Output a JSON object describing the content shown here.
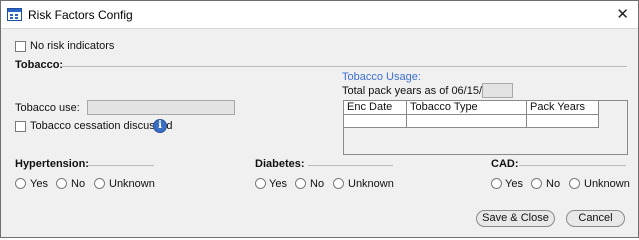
{
  "window": {
    "title": "Risk Factors Config"
  },
  "no_risk": {
    "label": "No risk indicators"
  },
  "tobacco": {
    "section_label": "Tobacco:",
    "usage_link": "Tobacco Usage:",
    "total_pack_years_label": "Total pack years as of 06/15/2020:",
    "total_pack_years_value": "",
    "use_label": "Tobacco use:",
    "use_value": "",
    "cessation_label": "Tobacco cessation discussed",
    "info_icon_glyph": "i",
    "grid": {
      "columns": [
        "Enc Date",
        "Tobacco Type",
        "Pack Years"
      ],
      "rows": [
        [
          "",
          "",
          ""
        ]
      ]
    }
  },
  "conditions": {
    "hypertension": {
      "label": "Hypertension:",
      "options": [
        "Yes",
        "No",
        "Unknown"
      ]
    },
    "diabetes": {
      "label": "Diabetes:",
      "options": [
        "Yes",
        "No",
        "Unknown"
      ]
    },
    "cad": {
      "label": "CAD:",
      "options": [
        "Yes",
        "No",
        "Unknown"
      ]
    }
  },
  "buttons": {
    "save_close": "Save & Close",
    "cancel": "Cancel"
  },
  "icons": {
    "close": "✕"
  },
  "colors": {
    "link": "#3b6fd1",
    "info_icon": "#3a6fc4"
  }
}
